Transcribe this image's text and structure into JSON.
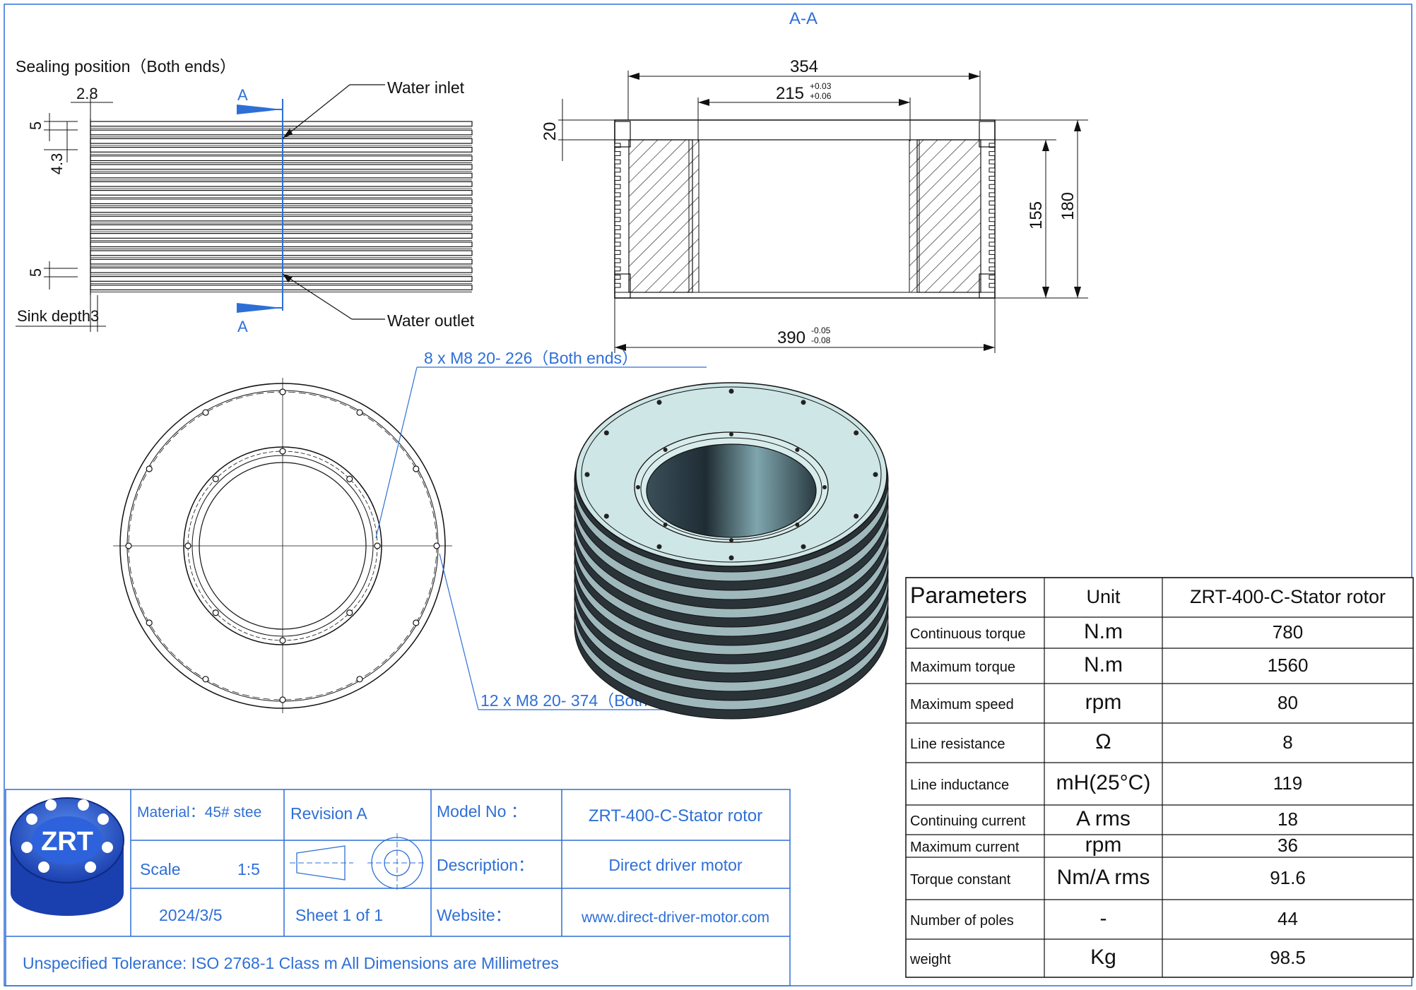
{
  "section_label": "A-A",
  "notes": {
    "sealing": "Sealing position（Both ends）",
    "water_inlet": "Water inlet",
    "water_outlet": "Water outlet",
    "sink_depth": "Sink depth3",
    "section_mark": "A"
  },
  "dims_left": {
    "d1": "2.8",
    "d2": "5",
    "d3": "4.3",
    "d4": "5"
  },
  "dims_section": {
    "d354": "354",
    "d215": "215",
    "d215_tol_up": "+0.03",
    "d215_tol_dn": "+0.06",
    "d20": "20",
    "d155": "155",
    "d180": "180",
    "d390": "390",
    "d390_tol_up": "-0.05",
    "d390_tol_dn": "-0.08"
  },
  "hole_notes": {
    "inner": "8 x M8 20- 226（Both ends）",
    "outer": "12 x M8 20- 374（Both ends）"
  },
  "params_table": {
    "headers": [
      "Parameters",
      "Unit",
      "ZRT-400-C-Stator rotor"
    ],
    "rows": [
      [
        "Continuous torque",
        "N.m",
        "780"
      ],
      [
        "Maximum torque",
        "N.m",
        "1560"
      ],
      [
        "Maximum speed",
        "rpm",
        "80"
      ],
      [
        "Line resistance",
        "Ω",
        "8"
      ],
      [
        "Line inductance",
        "mH(25°C)",
        "119"
      ],
      [
        "Continuing current",
        "A rms",
        "18"
      ],
      [
        "Maximum current",
        "rpm",
        "36"
      ],
      [
        "Torque constant",
        "Nm/A rms",
        "91.6"
      ],
      [
        "Number of poles",
        "-",
        "44"
      ],
      [
        "weight",
        "Kg",
        "98.5"
      ]
    ]
  },
  "title_block": {
    "logo_text": "ZRT",
    "material": "Material：45# stee",
    "revision": "Revision A",
    "model_label": "Model No ：",
    "model_value": "ZRT-400-C-Stator rotor",
    "scale_label": "Scale",
    "scale_value": "1:5",
    "description_label": "Description：",
    "description_value": "Direct driver motor",
    "date": "2024/3/5",
    "sheet": "Sheet 1 of 1",
    "website_label": "Website：",
    "website_value": "www.direct-driver-motor.com",
    "tolerance_note": "Unspecified Tolerance: ISO 2768-1 Class m   All Dimensions are Millimetres"
  },
  "colors": {
    "annotation_blue": "#2e6fd6",
    "line_black": "#111111",
    "logo_blue": "#1f4fc4"
  }
}
